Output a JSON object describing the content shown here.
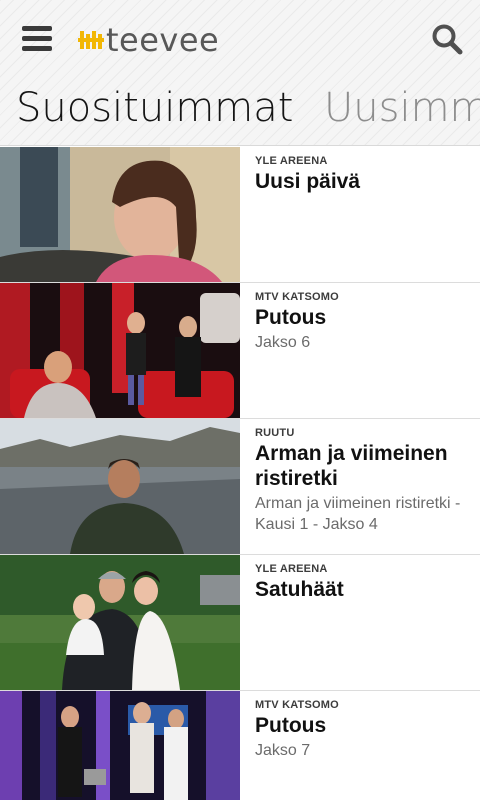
{
  "app": {
    "logo_text": "teevee",
    "brand_color": "#f2b705",
    "icons": [
      "menu-icon",
      "logo-mark-icon",
      "search-icon"
    ]
  },
  "tabs": [
    {
      "label": "Suosituimmat",
      "active": true
    },
    {
      "label": "Uusimmat",
      "active": false
    }
  ],
  "items": [
    {
      "channel": "YLE AREENA",
      "title": "Uusi päivä",
      "subtitle": ""
    },
    {
      "channel": "MTV KATSOMO",
      "title": "Putous",
      "subtitle": "Jakso 6"
    },
    {
      "channel": "RUUTU",
      "title": "Arman ja viimeinen ristiretki",
      "subtitle": "Arman ja viimeinen ristiretki - Kausi 1 - Jakso 4"
    },
    {
      "channel": "YLE AREENA",
      "title": "Satuhäät",
      "subtitle": ""
    },
    {
      "channel": "MTV KATSOMO",
      "title": "Putous",
      "subtitle": "Jakso 7"
    }
  ]
}
